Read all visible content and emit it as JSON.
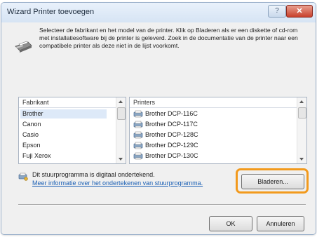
{
  "window": {
    "title": "Wizard Printer toevoegen"
  },
  "titlebar": {
    "help_label": "?",
    "close_label": "✕"
  },
  "description": "Selecteer de fabrikant en het model van de printer. Klik op Bladeren als er een diskette of cd-rom met installatiesoftware bij de printer is geleverd. Zoek in de documentatie van de printer naar een compatibele printer als deze niet in de lijst voorkomt.",
  "manufacturers": {
    "header": "Fabrikant",
    "items": [
      "Brother",
      "Canon",
      "Casio",
      "Epson",
      "Fuji Xerox"
    ],
    "selected": "Brother"
  },
  "printers": {
    "header": "Printers",
    "items": [
      "Brother DCP-116C",
      "Brother DCP-117C",
      "Brother DCP-128C",
      "Brother DCP-129C",
      "Brother DCP-130C"
    ]
  },
  "signature": {
    "text": "Dit stuurprogramma is digitaal ondertekend.",
    "link": "Meer informatie over het ondertekenen van stuurprogramma."
  },
  "buttons": {
    "browse": "Bladeren...",
    "ok": "OK",
    "cancel": "Annuleren"
  },
  "colors": {
    "highlight": "#f29a1d",
    "link": "#1a5fb4"
  }
}
